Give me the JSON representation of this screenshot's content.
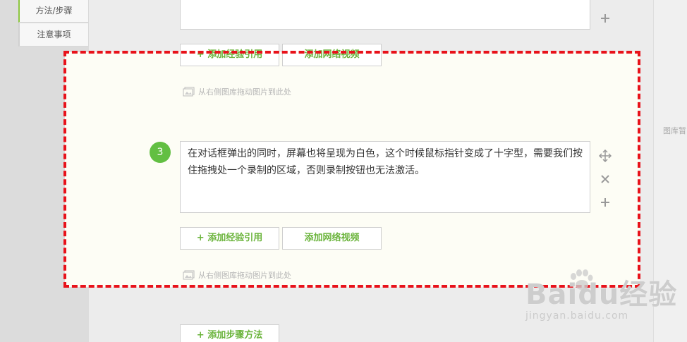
{
  "nav": {
    "items": [
      {
        "label": "方法/步骤",
        "active": true
      },
      {
        "label": "注意事项",
        "active": false
      }
    ]
  },
  "step_above": {
    "add_quote_label": "+ 添加经验引用",
    "add_video_label": "添加网络视频",
    "image_hint": "从右侧图库拖动图片到此处"
  },
  "step3": {
    "number": "3",
    "text": "在对话框弹出的同时，屏幕也将呈现为白色，这个时候鼠标指针变成了十字型，需要我们按住拖拽处一个录制的区域，否则录制按钮也无法激活。",
    "add_quote_label": "+ 添加经验引用",
    "add_video_label": "添加网络视频",
    "image_hint": "从右侧图库拖动图片到此处"
  },
  "add_step_label": "+ 添加步骤方法",
  "right_panel": {
    "text": "图库暂"
  },
  "watermark": {
    "logo": "Baidu经验",
    "url": "jingyan.baidu.com"
  },
  "colors": {
    "accent_green": "#6bb43c",
    "step_badge": "#62bf42",
    "dashed_border": "#e8121a"
  }
}
